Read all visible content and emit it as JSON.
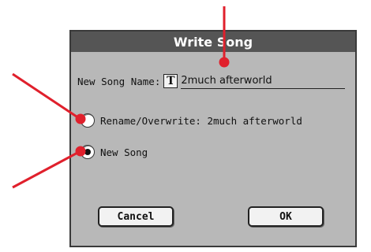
{
  "dialog": {
    "title": "Write Song",
    "name_label": "New Song Name:",
    "text_icon_glyph": "T",
    "name_value": "2much afterworld",
    "options": [
      {
        "label": "Rename/Overwrite: 2much afterworld",
        "selected": false
      },
      {
        "label": "New Song",
        "selected": true
      }
    ],
    "cancel_label": "Cancel",
    "ok_label": "OK"
  },
  "colors": {
    "annotation": "#e0202c",
    "dialog_bg": "#b8b8b8",
    "titlebar_bg": "#555555"
  }
}
